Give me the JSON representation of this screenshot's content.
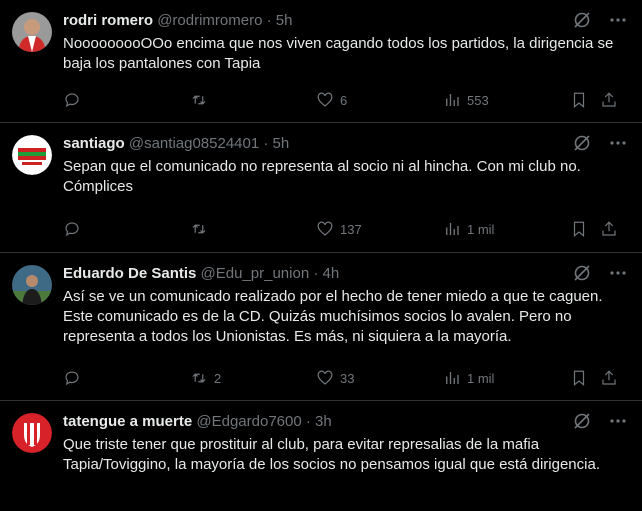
{
  "tweets": [
    {
      "name": "rodri romero",
      "handle": "@rodrimromero",
      "dot": "·",
      "time": "5h",
      "text": "NooooooooOOo encima que nos viven cagando todos los partidos, la dirigencia se baja los pantalones con Tapia",
      "replies": "",
      "reposts": "",
      "likes": "6",
      "views": "553"
    },
    {
      "name": "santiago",
      "handle": "@santiag08524401",
      "dot": "·",
      "time": "5h",
      "text": "Sepan que el comunicado no representa al socio ni al hincha. Con mi club no. Cómplices",
      "replies": "",
      "reposts": "",
      "likes": "137",
      "views": "1 mil"
    },
    {
      "name": "Eduardo De Santis",
      "handle": "@Edu_pr_union",
      "dot": "·",
      "time": "4h",
      "text": "Así se ve un comunicado realizado por el hecho de tener miedo a que te caguen. Este comunicado es de la CD. Quizás muchísimos socios lo avalen. Pero no representa a todos los Unionistas. Es más, ni siquiera a la mayoría.",
      "replies": "",
      "reposts": "2",
      "likes": "33",
      "views": "1 mil"
    },
    {
      "name": "tatengue a muerte",
      "handle": "@Edgardo7600",
      "dot": "·",
      "time": "3h",
      "text": "Que triste tener que prostituir al club, para evitar represalias de la mafia Tapia/Toviggino, la mayoría de los socios no pensamos igual que está dirigencia."
    }
  ],
  "icons": {
    "reply": "reply-icon",
    "repost": "repost-icon",
    "like": "heart-icon",
    "views": "views-icon",
    "bookmark": "bookmark-icon",
    "share": "share-icon",
    "grok": "grok-icon",
    "more": "more-icon"
  },
  "colors": {
    "background": "#000000",
    "text": "#e7e9ea",
    "secondary": "#71767b",
    "divider": "#2f3336"
  }
}
